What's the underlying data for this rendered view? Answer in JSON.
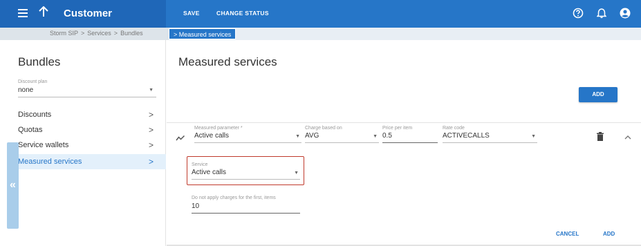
{
  "topbar": {
    "title": "Customer",
    "save_label": "SAVE",
    "change_status_label": "CHANGE STATUS",
    "icons": [
      "help-icon",
      "bell-icon",
      "account-icon"
    ]
  },
  "breadcrumb": {
    "items": [
      "Storm SIP",
      ">",
      "Services",
      ">",
      "Bundles"
    ],
    "active": "> Measured services"
  },
  "left_panel": {
    "title": "Bundles",
    "discount_plan_label": "Discount plan",
    "discount_plan_value": "none",
    "nav_items": [
      {
        "label": "Discounts",
        "active": false
      },
      {
        "label": "Quotas",
        "active": false
      },
      {
        "label": "Service wallets",
        "active": false
      },
      {
        "label": "Measured services",
        "active": true
      }
    ],
    "collapse_glyph": "«"
  },
  "main": {
    "title": "Measured services",
    "add_label": "ADD",
    "row": {
      "measured_parameter_label": "Measured parameter *",
      "measured_parameter_value": "Active calls",
      "charge_based_on_label": "Charge based on",
      "charge_based_on_value": "AVG",
      "price_per_item_label": "Price per item",
      "price_per_item_value": "0.5",
      "rate_code_label": "Rate code",
      "rate_code_value": "ACTIVECALLS",
      "service_label": "Service",
      "service_value": "Active calls",
      "no_charge_label": "Do not apply charges for the first, items",
      "no_charge_value": "10"
    },
    "cancel_label": "CANCEL",
    "footer_add_label": "ADD"
  },
  "colors": {
    "primary": "#2676c8",
    "active_nav_bg": "#e3f0fb",
    "highlight_border": "#c0392b"
  }
}
